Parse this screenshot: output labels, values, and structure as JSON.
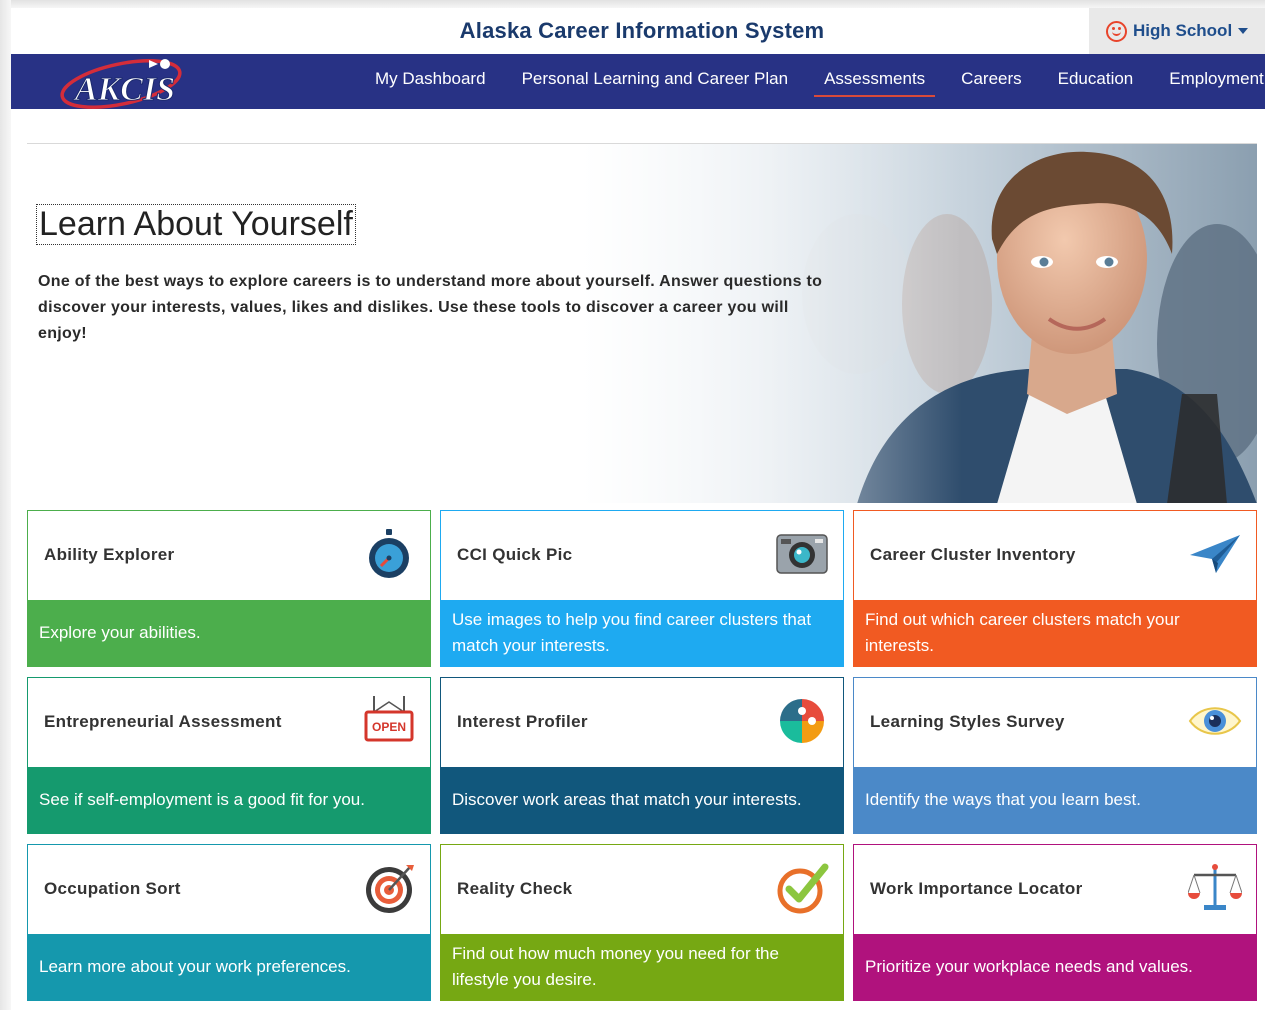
{
  "header": {
    "site_title": "Alaska Career Information System",
    "level_selector": {
      "label": "High School",
      "icon": "face-icon",
      "color": "#e8442b"
    },
    "logo_text": "AKCIS"
  },
  "nav": {
    "items": [
      "My Dashboard",
      "Personal Learning and Career Plan",
      "Assessments",
      "Careers",
      "Education",
      "Employment"
    ],
    "active": "Assessments",
    "background": "#283285"
  },
  "hero": {
    "title": "Learn About Yourself",
    "text": "One of the best ways to explore careers is to understand more about yourself. Answer questions to discover your interests, values, likes and dislikes. Use these tools to discover a career you will enjoy!"
  },
  "cards": [
    {
      "title": "Ability Explorer",
      "description": "Explore your abilities.",
      "icon": "stopwatch-icon",
      "color": "#4cae4c"
    },
    {
      "title": "CCI Quick Pic",
      "description": "Use images to help you find career clusters that match your interests.",
      "icon": "camera-icon",
      "color": "#1eaaf1"
    },
    {
      "title": "Career Cluster Inventory",
      "description": "Find out which career clusters match your interests.",
      "icon": "paper-plane-icon",
      "color": "#f15a22"
    },
    {
      "title": "Entrepreneurial Assessment",
      "description": "See if self-employment is a good fit for you.",
      "icon": "open-sign-icon",
      "color": "#159a6e"
    },
    {
      "title": "Interest Profiler",
      "description": "Discover work areas that match your interests.",
      "icon": "puzzle-icon",
      "color": "#11577c"
    },
    {
      "title": "Learning Styles Survey",
      "description": "Identify the ways that you learn best.",
      "icon": "eye-icon",
      "color": "#4b89c8"
    },
    {
      "title": "Occupation Sort",
      "description": "Learn more about your work preferences.",
      "icon": "target-icon",
      "color": "#1598ad"
    },
    {
      "title": "Reality Check",
      "description": "Find out how much money you need for the lifestyle you desire.",
      "icon": "checkmark-icon",
      "color": "#76a813"
    },
    {
      "title": "Work Importance Locator",
      "description": "Prioritize your workplace needs and values.",
      "icon": "scales-icon",
      "color": "#b0127d"
    }
  ]
}
